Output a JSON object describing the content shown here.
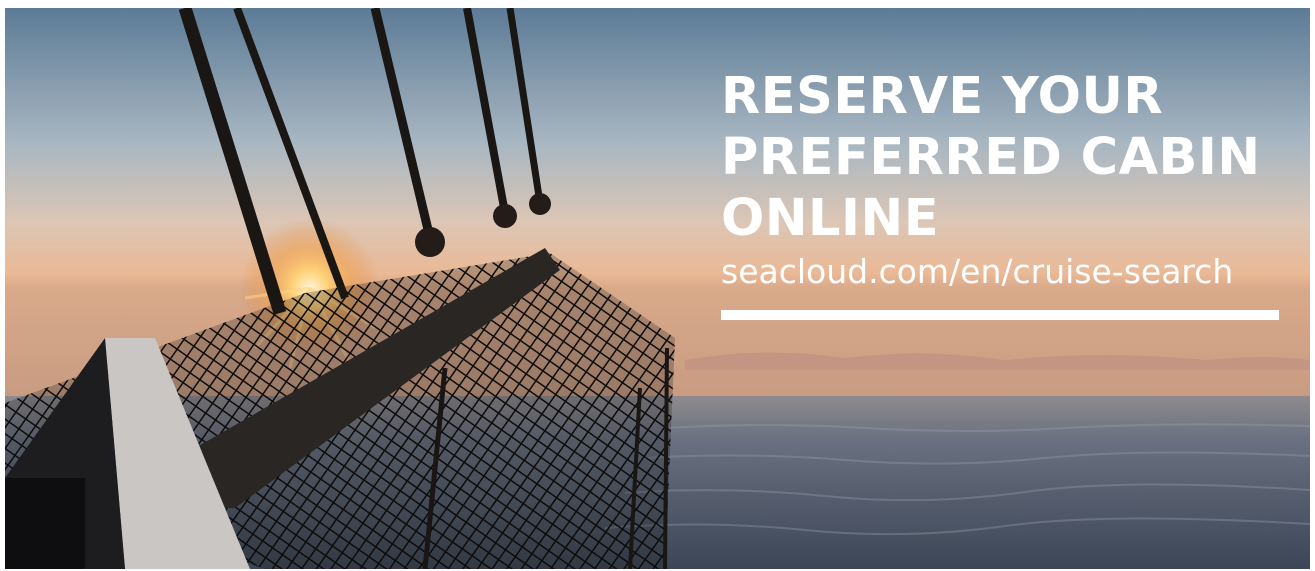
{
  "banner": {
    "headline_lines": [
      "RESERVE YOUR",
      "PREFERRED CABIN",
      "ONLINE"
    ],
    "url": "seacloud.com/en/cruise-search"
  },
  "colors": {
    "text": "#ffffff",
    "sky_top": "#5f7f99",
    "sky_horizon": "#e9b791",
    "sea": "#4a5768"
  }
}
